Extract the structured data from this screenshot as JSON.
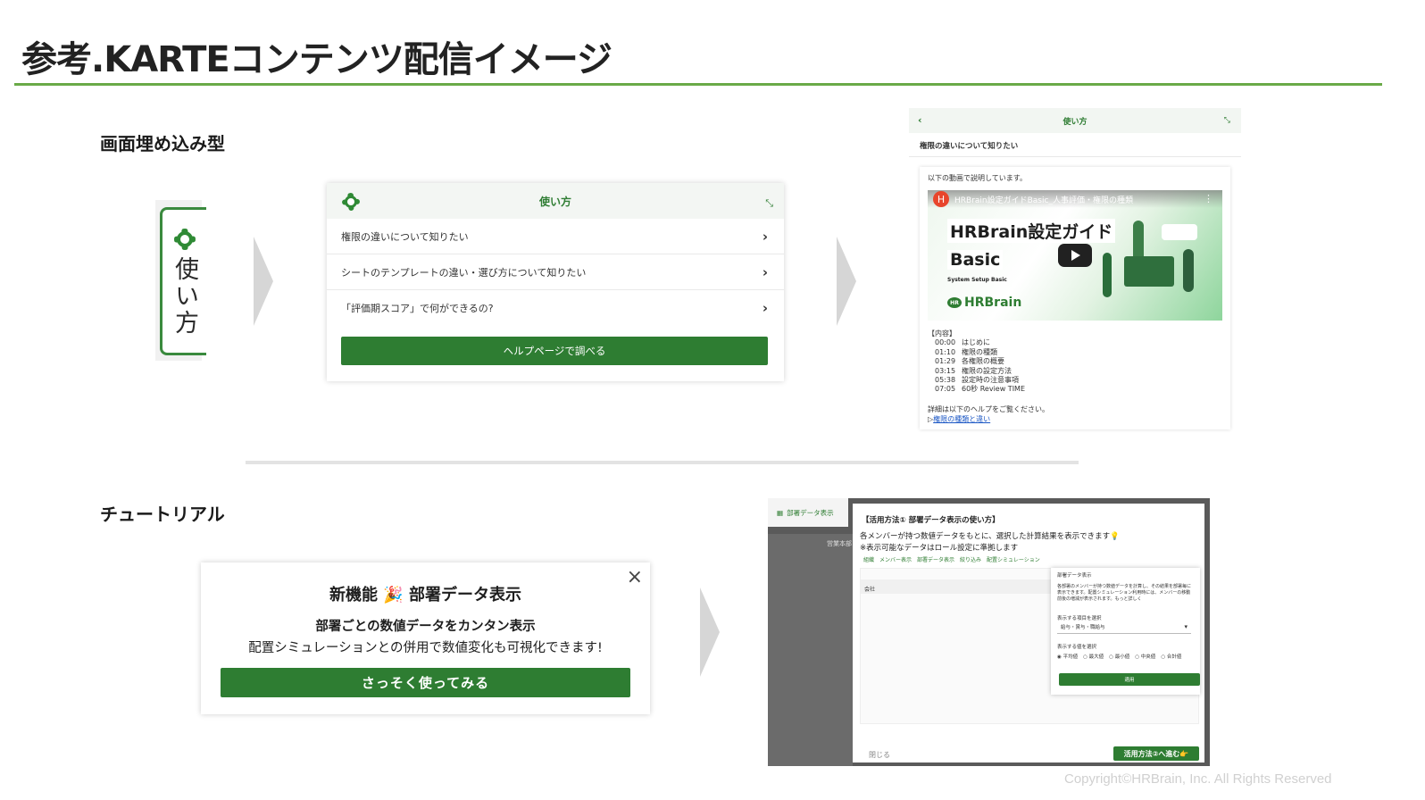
{
  "title": "参考.KARTEコンテンツ配信イメージ",
  "colors": {
    "accent_green": "#6aaa48",
    "button_green": "#2e7d32",
    "link_blue": "#1a56c4"
  },
  "embed": {
    "section_label": "画面埋め込み型",
    "tab_label": "使い方",
    "widget": {
      "title": "使い方",
      "items": [
        "権限の違いについて知りたい",
        "シートのテンプレートの違い・選び方について知りたい",
        "「評価期スコア」で何ができるの?"
      ],
      "cta": "ヘルプページで調べる"
    },
    "detail": {
      "title": "使い方",
      "subject": "権限の違いについて知りたい",
      "intro": "以下の動画で説明しています。",
      "video": {
        "avatar": "H",
        "channel_title": "HRBrain設定ガイドBasic_人事評価・権限の種類",
        "heading1": "HRBrain設定ガイド",
        "heading2": "Basic",
        "heading3": "System Setup Basic",
        "brand": "HRBrain",
        "brand_badge": "HR"
      },
      "contents_header": "【内容】",
      "toc": [
        {
          "t": "00:00",
          "label": "はじめに"
        },
        {
          "t": "01:10",
          "label": "権限の種類"
        },
        {
          "t": "01:29",
          "label": "各権限の概要"
        },
        {
          "t": "03:15",
          "label": "権限の設定方法"
        },
        {
          "t": "05:38",
          "label": "設定時の注意事項"
        },
        {
          "t": "07:05",
          "label": "60秒 Review TIME"
        }
      ],
      "more_text": "詳細は以下のヘルプをご覧ください。",
      "link_prefix": "▷",
      "link_text": "権限の種類と違い"
    }
  },
  "tutorial": {
    "section_label": "チュートリアル",
    "popup": {
      "title": "新機能 🎉 部署データ表示",
      "subtitle": "部署ごとの数値データをカンタン表示",
      "description": "配置シミュレーションとの併用で数値変化も可視化できます!",
      "cta": "さっそく使ってみる"
    },
    "screenshot": {
      "sidebar_tab": "部署データ表示",
      "bg_label": "営業本部",
      "modal_title": "【活用方法① 部署データ表示の使い方】",
      "line1": "各メンバーが持つ数値データをもとに、選択した計算結果を表示できます💡",
      "line2": "※表示可能なデータはロール設定に準拠します",
      "toolbar": "組織　メンバー表示　部署データ表示　絞り込み　配置シミュレーション",
      "company": "会社",
      "popover": {
        "title": "部署データ表示",
        "description": "各部署のメンバーが持つ数値データを計算し、その結果を部署毎に表示できます。配置シミュレーション利用時には、メンバーの移動前後の増減が表示されます。もっと詳しく",
        "label1": "表示する項目を選択",
        "select_value": "給与・賞与・職給与",
        "label2": "表示する値を選択",
        "radios": [
          "平均値",
          "最大値",
          "最小値",
          "中央値",
          "合計値"
        ],
        "apply": "適用"
      },
      "close": "閉じる",
      "next": "活用方法②へ進む👉"
    }
  },
  "copyright": "Copyright©HRBrain, Inc. All Rights Reserved"
}
